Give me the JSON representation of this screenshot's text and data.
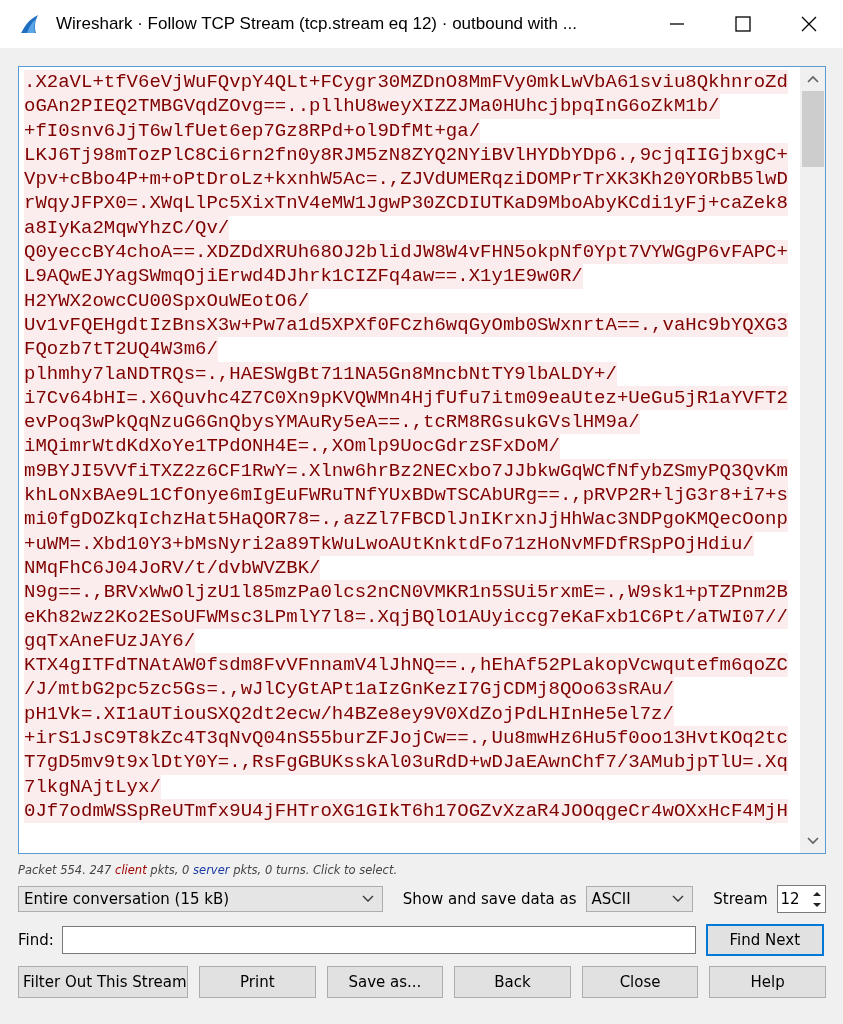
{
  "window": {
    "title": "Wireshark · Follow TCP Stream (tcp.stream eq 12) · outbound with ..."
  },
  "stream": {
    "lines": [
      ".X2aVL+tfV6eVjWuFQvpY4QLt+FCygr30MZDnO8MmFVy0mkLwVbA61sviu8QkhnroZd",
      "oGAn2PIEQ2TMBGVqdZOvg==..pllhU8weyXIZZJMa0HUhcjbpqInG6oZkM1b/",
      "+fI0snv6JjT6wlfUet6ep7Gz8RPd+ol9DfMt+ga/",
      "LKJ6Tj98mTozPlC8Ci6rn2fn0y8RJM5zN8ZYQ2NYiBVlHYDbYDp6.,9cjqIIGjbxgC+",
      "Vpv+cBbo4P+m+oPtDroLz+kxnhW5Ac=.,ZJVdUMERqziDOMPrTrXK3Kh20YORbB5lwD",
      "rWqyJFPX0=.XWqLlPc5XixTnV4eMW1JgwP30ZCDIUTKaD9MboAbyKCdi1yFj+caZek8",
      "a8IyKa2MqwYhzC/Qv/",
      "Q0yeccBY4choA==.XDZDdXRUh68OJ2blidJW8W4vFHN5okpNf0Ypt7VYWGgP6vFAPC+",
      "L9AQwEJYagSWmqOjiErwd4DJhrk1CIZFq4aw==.X1y1E9w0R/",
      "H2YWX2owcCU00SpxOuWEotO6/",
      "Uv1vFQEHgdtIzBnsX3w+Pw7a1d5XPXf0FCzh6wqGyOmb0SWxnrtA==.,vaHc9bYQXG3",
      "FQozb7tT2UQ4W3m6/",
      "plhmhy7laNDTRQs=.,HAESWgBt711NA5Gn8MncbNtTY9lbALDY+/",
      "i7Cv64bHI=.X6Quvhc4Z7C0Xn9pKVQWMn4HjfUfu7itm09eaUtez+UeGu5jR1aYVFT2",
      "evPoq3wPkQqNzuG6GnQbysYMAuRy5eA==.,tcRM8RGsukGVslHM9a/",
      "iMQimrWtdKdXoYe1TPdONH4E=.,XOmlp9UocGdrzSFxDoM/",
      "m9BYJI5VVfiTXZ2z6CF1RwY=.Xlnw6hrBz2NECxbo7JJbkwGqWCfNfybZSmyPQ3QvKm",
      "khLoNxBAe9L1CfOnye6mIgEuFWRuTNfYUxBDwTSCAbURg==.,pRVP2R+ljG3r8+i7+s",
      "mi0fgDOZkqIchzHat5HaQOR78=.,azZl7FBCDlJnIKrxnJjHhWac3NDPgoKMQecOonp",
      "+uWM=.Xbd10Y3+bMsNyri2a89TkWuLwoAUtKnktdFo71zHoNvMFDfRSpPOjHdiu/",
      "NMqFhC6J04JoRV/t/dvbWVZBK/",
      "N9g==.,BRVxWwOljzU1l85mzPa0lcs2nCN0VMKR1n5SUi5rxmE=.,W9sk1+pTZPnm2B",
      "eKh82wz2Ko2ESoUFWMsc3LPmlY7l8=.XqjBQlO1AUyiccg7eKaFxb1C6Pt/aTWI07//",
      "gqTxAneFUzJAY6/",
      "KTX4gITFdTNAtAW0fsdm8FvVFnnamV4lJhNQ==.,hEhAf52PLakopVcwqutefm6qoZC",
      "/J/mtbG2pc5zc5Gs=.,wJlCyGtAPt1aIzGnKezI7GjCDMj8QOo63sRAu/",
      "pH1Vk=.XI1aUTiouSXQ2dt2ecw/h4BZe8ey9V0XdZojPdLHInHe5el7z/",
      "+irS1JsC9T8kZc4T3qNvQ04nS55burZFJojCw==.,Uu8mwHz6Hu5f0oo13HvtKOq2tc",
      "T7gD5mv9t9xlDtY0Y=.,RsFgGBUKsskAl03uRdD+wDJaEAwnChf7/3AMubjpTlU=.Xq",
      "7lkgNAjtLyx/",
      "0Jf7odmWSSpReUTmfx9U4jFHTroXG1GIkT6h17OGZvXzaR4JOOqgeCr4wOXxHcF4MjH"
    ]
  },
  "status": [
    {
      "kind": "plain",
      "text": "Packet 554. 247 "
    },
    {
      "kind": "client",
      "text": "client"
    },
    {
      "kind": "plain",
      "text": " pkts, 0 "
    },
    {
      "kind": "server",
      "text": "server"
    },
    {
      "kind": "plain",
      "text": " pkts, 0 turns. Click to select."
    }
  ],
  "conversation_select": {
    "value": "Entire conversation (15 kB)"
  },
  "format_label": "Show and save data as",
  "format_select": {
    "value": "ASCII"
  },
  "stream_label": "Stream",
  "stream_spinner": {
    "value": "12"
  },
  "find": {
    "label": "Find:",
    "button": {
      "label": "Find Next",
      "default": true
    }
  },
  "buttons": [
    {
      "label": "Filter Out This Stream",
      "default": false
    },
    {
      "label": "Print",
      "default": false
    },
    {
      "label": "Save as...",
      "default": false
    },
    {
      "label": "Back",
      "default": false
    },
    {
      "label": "Close",
      "default": false
    },
    {
      "label": "Help",
      "default": false
    }
  ]
}
